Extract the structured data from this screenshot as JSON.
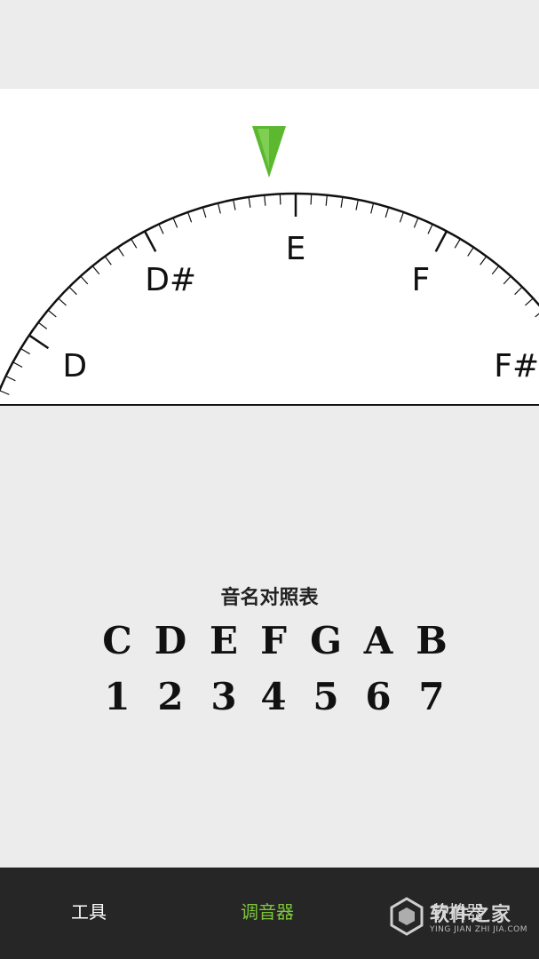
{
  "tuner": {
    "indicator_color": "#5cb82e",
    "current_note": "E",
    "notes": [
      "D",
      "D#",
      "E",
      "F",
      "F#"
    ]
  },
  "reference_table": {
    "title": "音名对照表",
    "note_names": [
      "C",
      "D",
      "E",
      "F",
      "G",
      "A",
      "B"
    ],
    "solfege_numbers": [
      "1",
      "2",
      "3",
      "4",
      "5",
      "6",
      "7"
    ]
  },
  "nav": {
    "tools_label": "工具",
    "tuner_label": "调音器",
    "third_label": "节拍器",
    "active_color": "#7cc63a"
  },
  "watermark": {
    "brand": "软件之家",
    "url": "YING JIAN ZHI JIA.COM"
  }
}
